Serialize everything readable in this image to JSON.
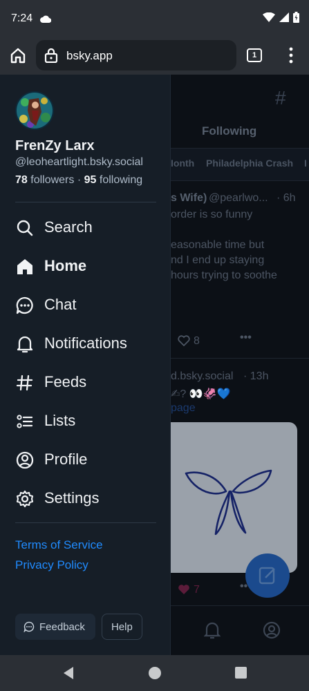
{
  "status_bar": {
    "time": "7:24"
  },
  "browser": {
    "url": "bsky.app",
    "tab_count": "1"
  },
  "feed_background": {
    "tab_following": "Following",
    "chips": [
      "Ionth",
      "Philadelphia Crash",
      "I"
    ],
    "post1": {
      "author": "s Wife)",
      "handle": "@pearlwo...",
      "time": "· 6h",
      "lines": [
        "order is so funny",
        "easonable time but",
        "nd I end up staying",
        "hours trying to soothe"
      ],
      "likes": "8"
    },
    "post2": {
      "handle": "d.bsky.social",
      "time": "· 13h",
      "line1": "✍? 👀🦑💙",
      "link": "page",
      "likes": "7"
    }
  },
  "drawer": {
    "display_name": "FrenZy Larx",
    "handle": "@leoheartlight.bsky.social",
    "followers_count": "78",
    "followers_label": "followers",
    "dot": "·",
    "following_count": "95",
    "following_label": "following",
    "nav": [
      {
        "label": "Search",
        "icon": "search-icon"
      },
      {
        "label": "Home",
        "icon": "home-icon"
      },
      {
        "label": "Chat",
        "icon": "chat-icon"
      },
      {
        "label": "Notifications",
        "icon": "bell-icon"
      },
      {
        "label": "Feeds",
        "icon": "hash-icon"
      },
      {
        "label": "Lists",
        "icon": "list-icon"
      },
      {
        "label": "Profile",
        "icon": "profile-icon"
      },
      {
        "label": "Settings",
        "icon": "gear-icon"
      }
    ],
    "terms": "Terms of Service",
    "privacy": "Privacy Policy",
    "feedback": "Feedback",
    "help": "Help"
  },
  "colors": {
    "accent": "#208bfe",
    "drawer_bg": "#161e27",
    "text": "#f1f3f5",
    "muted": "#aebbc9"
  }
}
